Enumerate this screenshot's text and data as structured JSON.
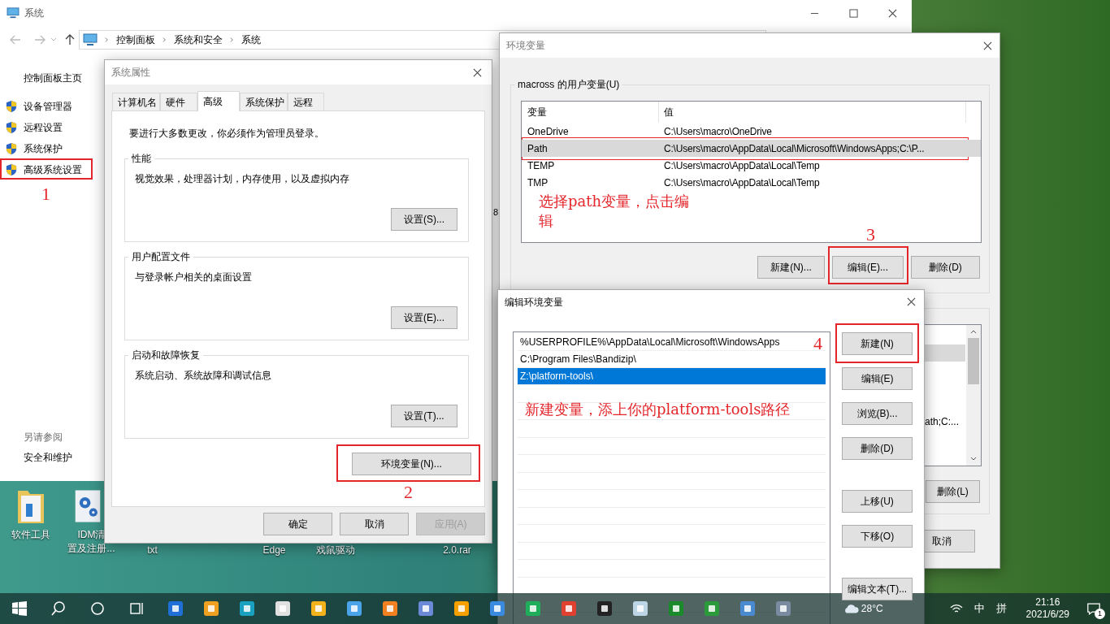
{
  "system_window": {
    "title": "系统",
    "breadcrumb": [
      "控制面板",
      "系统和安全",
      "系统"
    ],
    "sidebar": {
      "home": "控制面板主页",
      "links": [
        {
          "label": "设备管理器",
          "highlighted": false
        },
        {
          "label": "远程设置",
          "highlighted": false
        },
        {
          "label": "系统保护",
          "highlighted": false
        },
        {
          "label": "高级系统设置",
          "highlighted": true,
          "step": "1"
        }
      ],
      "see_also": "另请参阅",
      "see_also_links": [
        "安全和维护"
      ]
    },
    "cut_text": "8"
  },
  "desktop_icons": [
    {
      "kind": "folder",
      "lines": [
        "软件工具"
      ]
    },
    {
      "kind": "gear",
      "lines": [
        "IDM清",
        "置及注册..."
      ]
    },
    {
      "kind": "hidden",
      "lines": [
        "txt"
      ]
    },
    {
      "kind": "hidden",
      "lines": [
        "Edge"
      ]
    },
    {
      "kind": "hidden",
      "lines": [
        "戏鼠驱动"
      ]
    },
    {
      "kind": "hidden",
      "lines": [
        "2.0.rar"
      ]
    }
  ],
  "system_properties": {
    "title": "系统属性",
    "tabs": [
      {
        "label": "计算机名",
        "selected": false
      },
      {
        "label": "硬件",
        "selected": false
      },
      {
        "label": "高级",
        "selected": true
      },
      {
        "label": "系统保护",
        "selected": false
      },
      {
        "label": "远程",
        "selected": false
      }
    ],
    "notice": "要进行大多数更改，你必须作为管理员登录。",
    "groups": [
      {
        "title": "性能",
        "description": "视觉效果，处理器计划，内存使用，以及虚拟内存",
        "button": "设置(S)..."
      },
      {
        "title": "用户配置文件",
        "description": "与登录帐户相关的桌面设置",
        "button": "设置(E)..."
      },
      {
        "title": "启动和故障恢复",
        "description": "系统启动、系统故障和调试信息",
        "button": "设置(T)..."
      }
    ],
    "env_button": {
      "label": "环境变量(N)...",
      "highlighted": true,
      "step": "2"
    },
    "footer_buttons": [
      {
        "label": "确定",
        "disabled": false
      },
      {
        "label": "取消",
        "disabled": false
      },
      {
        "label": "应用(A)",
        "disabled": true
      }
    ]
  },
  "environment_variables": {
    "title": "环境变量",
    "user_section": {
      "title": "macross 的用户变量(U)",
      "columns": [
        "变量",
        "值"
      ],
      "rows": [
        {
          "name": "OneDrive",
          "value": "C:\\Users\\macro\\OneDrive",
          "selected": false,
          "highlighted": false
        },
        {
          "name": "Path",
          "value": "C:\\Users\\macro\\AppData\\Local\\Microsoft\\WindowsApps;C:\\P...",
          "selected": true,
          "highlighted": true
        },
        {
          "name": "TEMP",
          "value": "C:\\Users\\macro\\AppData\\Local\\Temp",
          "selected": false,
          "highlighted": false
        },
        {
          "name": "TMP",
          "value": "C:\\Users\\macro\\AppData\\Local\\Temp",
          "selected": false,
          "highlighted": false
        }
      ],
      "note": "选择path变量，点击编辑",
      "buttons": [
        {
          "label": "新建(N)...",
          "highlighted": false
        },
        {
          "label": "编辑(E)...",
          "highlighted": true,
          "step": "3"
        },
        {
          "label": "删除(D)",
          "highlighted": false
        }
      ]
    },
    "system_section": {
      "rows": [
        {
          "selected": true
        },
        {
          "text": "ath;C:...",
          "selected": false
        }
      ],
      "buttons": [
        "删除(L)"
      ]
    },
    "dialog_buttons": [
      "取消"
    ]
  },
  "edit_variable": {
    "title": "编辑环境变量",
    "entries": [
      {
        "text": "%USERPROFILE%\\AppData\\Local\\Microsoft\\WindowsApps",
        "selected": false
      },
      {
        "text": "C:\\Program Files\\Bandizip\\",
        "selected": false
      },
      {
        "text": "Z:\\platform-tools\\",
        "selected": true
      }
    ],
    "note": "新建变量，添上你的platform-tools路径",
    "button_groups": [
      [
        {
          "label": "新建(N)",
          "highlighted": true,
          "step": "4"
        },
        {
          "label": "编辑(E)",
          "highlighted": false
        },
        {
          "label": "浏览(B)...",
          "highlighted": false
        },
        {
          "label": "删除(D)",
          "highlighted": false
        }
      ],
      [
        {
          "label": "上移(U)",
          "highlighted": false
        },
        {
          "label": "下移(O)",
          "highlighted": false
        }
      ],
      [
        {
          "label": "编辑文本(T)...",
          "highlighted": false
        }
      ]
    ]
  },
  "taskbar": {
    "weather": "28°C",
    "ime": [
      "中",
      "拼"
    ],
    "time": "21:16",
    "date": "2021/6/29",
    "notifications": "1"
  }
}
